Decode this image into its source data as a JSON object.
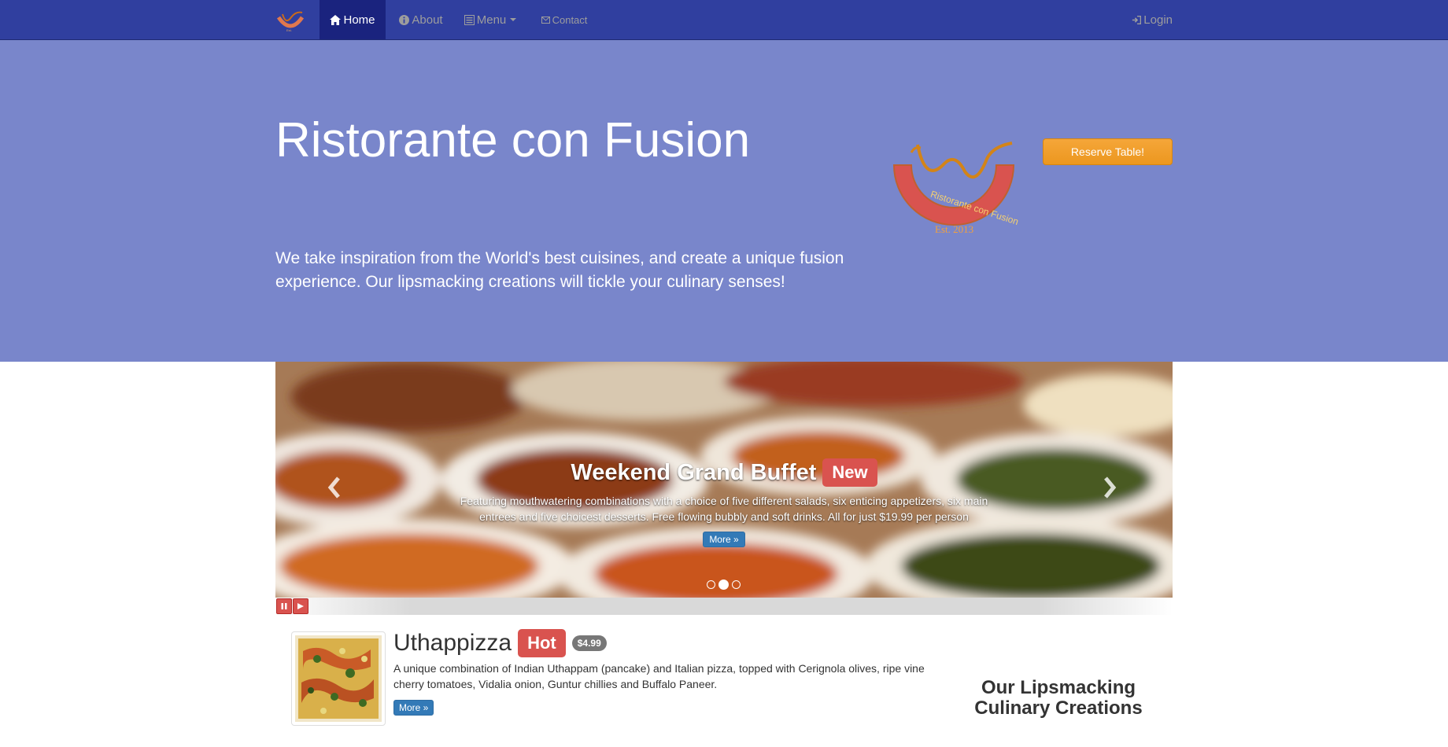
{
  "navbar": {
    "brand_icon": "restaurant-logo",
    "items": [
      {
        "label": "Home",
        "icon": "home-icon",
        "active": true
      },
      {
        "label": "About",
        "icon": "info-sign-icon"
      },
      {
        "label": "Menu",
        "icon": "list-alt-icon"
      },
      {
        "label": "Contact",
        "icon": "envelope-icon"
      }
    ],
    "login": {
      "label": "Login",
      "icon": "log-in-icon"
    }
  },
  "hero": {
    "title": "Ristorante con Fusion",
    "text": "We take inspiration from the World's best cuisines, and create a unique fusion experience. Our lipsmacking creations will tickle your culinary senses!",
    "logo_text": "Ristorante con Fusion",
    "logo_est": "Est. 2013",
    "reserve_label": "Reserve Table!"
  },
  "carousel": {
    "title": "Weekend Grand Buffet",
    "badge": "New",
    "description": "Featuring mouthwatering combinations with a choice of five different salads, six enticing appetizers, six main entrees and five choicest desserts. Free flowing bubbly and soft drinks. All for just $19.99 per person",
    "more_label": "More »",
    "indicators": 3,
    "active_indicator": 1
  },
  "featured": {
    "name": "Uthappizza",
    "badge": "Hot",
    "price": "$4.99",
    "description": "A unique combination of Indian Uthappam (pancake) and Italian pizza, topped with Cerignola olives, ripe vine cherry tomatoes, Vidalia onion, Guntur chillies and Buffalo Paneer.",
    "more_label": "More »"
  },
  "sidebar": {
    "heading": "Our Lipsmacking Culinary Creations"
  },
  "colors": {
    "navbar": "#303F9F",
    "navbar_active": "#1a237e",
    "jumbotron": "#7986CB",
    "reserve": "#ec971f",
    "danger": "#d9534f",
    "primary": "#337ab7"
  }
}
